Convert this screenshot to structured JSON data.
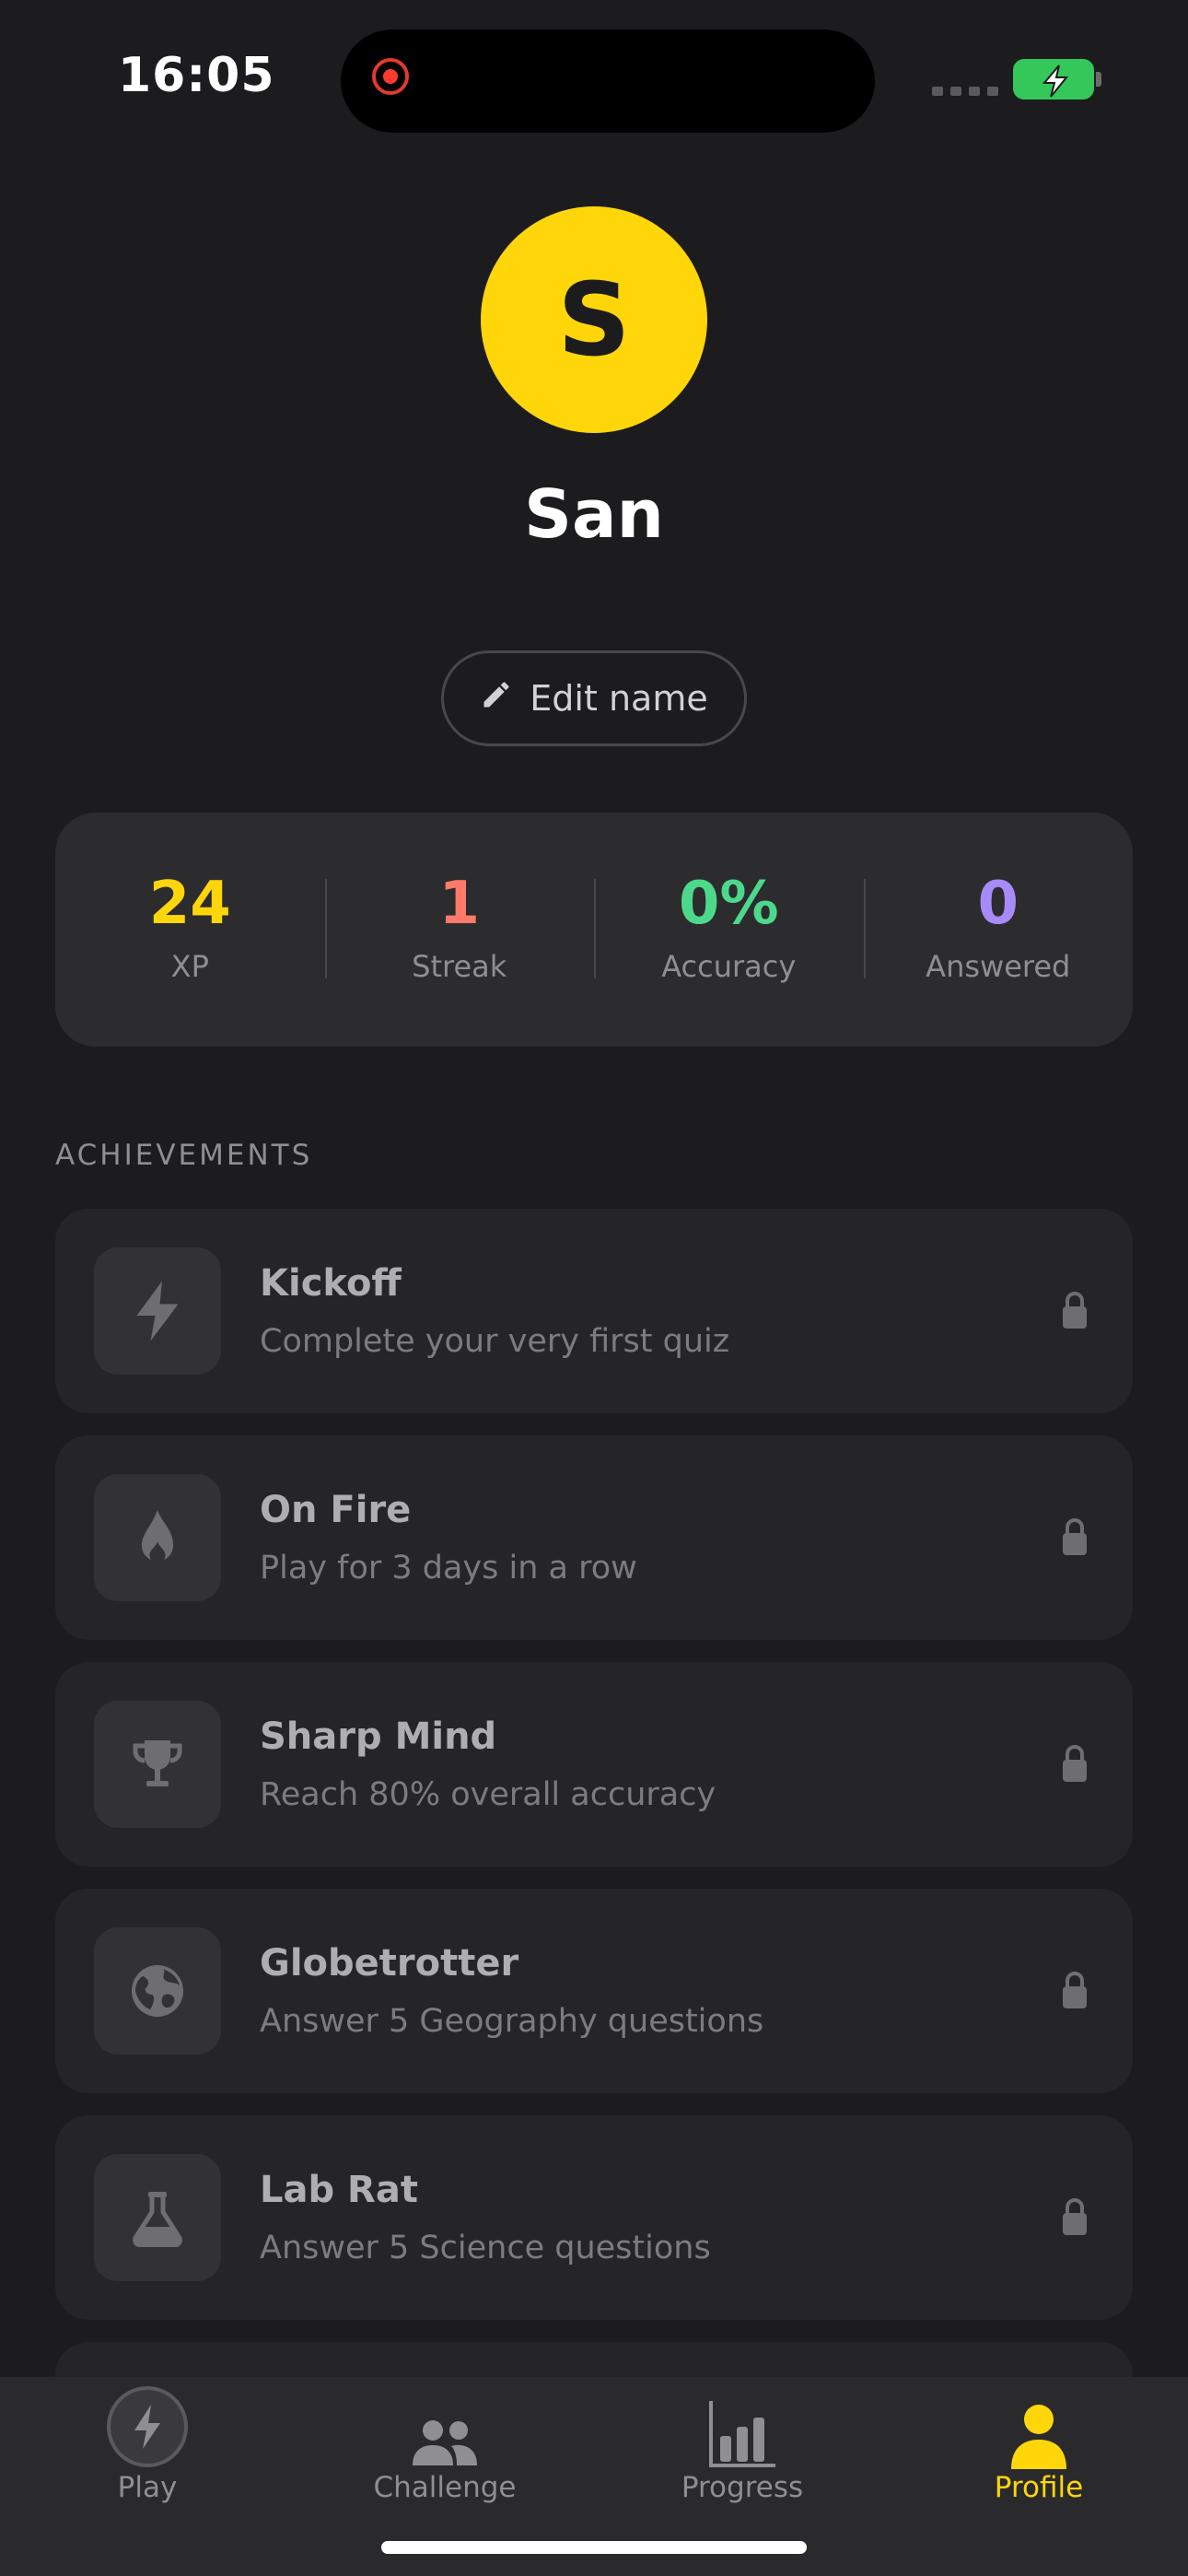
{
  "status_bar": {
    "time": "16:05"
  },
  "profile": {
    "avatar_letter": "S",
    "name": "San",
    "edit_label": "Edit name"
  },
  "stats": [
    {
      "value": "24",
      "label": "XP",
      "color": "#ffd60a"
    },
    {
      "value": "1",
      "label": "Streak",
      "color": "#ff7a6b"
    },
    {
      "value": "0%",
      "label": "Accuracy",
      "color": "#4cd98c"
    },
    {
      "value": "0",
      "label": "Answered",
      "color": "#a78bfa"
    }
  ],
  "achievements": {
    "title": "ACHIEVEMENTS",
    "items": [
      {
        "title": "Kickoff",
        "desc": "Complete your very first quiz",
        "icon": "lightning-icon",
        "locked": true
      },
      {
        "title": "On Fire",
        "desc": "Play for 3 days in a row",
        "icon": "flame-icon",
        "locked": true
      },
      {
        "title": "Sharp Mind",
        "desc": "Reach 80% overall accuracy",
        "icon": "trophy-icon",
        "locked": true
      },
      {
        "title": "Globetrotter",
        "desc": "Answer 5 Geography questions",
        "icon": "globe-icon",
        "locked": true
      },
      {
        "title": "Lab Rat",
        "desc": "Answer 5 Science questions",
        "icon": "flask-icon",
        "locked": true
      }
    ]
  },
  "tabs": [
    {
      "label": "Play",
      "icon": "lightning-icon",
      "active": false
    },
    {
      "label": "Challenge",
      "icon": "people-icon",
      "active": false
    },
    {
      "label": "Progress",
      "icon": "bar-chart-icon",
      "active": false
    },
    {
      "label": "Profile",
      "icon": "person-icon",
      "active": true
    }
  ],
  "colors": {
    "accent": "#ffd60a",
    "background": "#1c1c1e",
    "card": "#2c2c2e"
  }
}
